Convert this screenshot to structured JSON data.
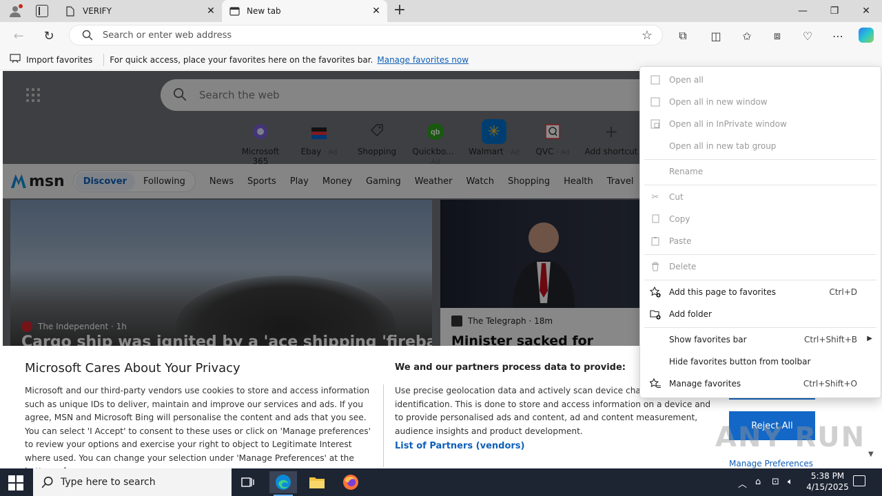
{
  "browser": {
    "tabs": [
      {
        "label": "VERIFY",
        "active": false
      },
      {
        "label": "New tab",
        "active": true
      }
    ],
    "address_placeholder": "Search or enter web address",
    "favorites_bar": {
      "import_label": "Import favorites",
      "hint": "For quick access, place your favorites here on the favorites bar.",
      "manage_link": "Manage favorites now"
    }
  },
  "newtab": {
    "search_placeholder": "Search the web",
    "shortcuts": [
      {
        "label": "Microsoft 365",
        "ad": ""
      },
      {
        "label": "Ebay",
        "ad": "· Ad"
      },
      {
        "label": "Shopping",
        "ad": ""
      },
      {
        "label": "Quickbo...",
        "ad": "· Ad"
      },
      {
        "label": "Walmart",
        "ad": "· Ad"
      },
      {
        "label": "QVC",
        "ad": "· Ad"
      },
      {
        "label": "Add shortcut",
        "ad": ""
      }
    ],
    "msn": {
      "logo": "msn",
      "segments": [
        "Discover",
        "Following"
      ],
      "nav": [
        "News",
        "Sports",
        "Play",
        "Money",
        "Gaming",
        "Weather",
        "Watch",
        "Shopping",
        "Health",
        "Travel"
      ]
    },
    "cards": [
      {
        "source": "The Independent",
        "time": "· 1h",
        "headline": "Cargo ship was ignited by a 'ace shipping 'fireballs'"
      },
      {
        "source": "The Telegraph",
        "time": "· 18m",
        "headline": "Minister sacked for"
      }
    ]
  },
  "privacy": {
    "title": "Microsoft Cares About Your Privacy",
    "body": "Microsoft and our third-party vendors use cookies to store and access information such as unique IDs to deliver, maintain and improve our services and ads. If you agree, MSN and Microsoft Bing will personalise the content and ads that you see. You can select 'I Accept' to consent to these uses or click on 'Manage preferences' to review your options and exercise your right to object to Legitimate Interest where used.  You can change your selection under 'Manage Preferences' at the bottom of",
    "col2_title": "We and our partners process data to provide:",
    "col2_body": "Use precise geolocation data and actively scan device characteristics for identification. This is done to store and access information on a device and to provide personalised ads and content, ad and content measurement, audience insights and product development.",
    "partners_link": "List of Partners (vendors)",
    "reject": "Reject All",
    "manage": "Manage Preferences",
    "watermark": "ANY RUN"
  },
  "context_menu": {
    "items": [
      {
        "label": "Open all",
        "shortcut": "",
        "disabled": true,
        "icon": "window-icon"
      },
      {
        "label": "Open all in new window",
        "shortcut": "",
        "disabled": true,
        "icon": "window-icon"
      },
      {
        "label": "Open all in InPrivate window",
        "shortcut": "",
        "disabled": true,
        "icon": "inprivate-icon"
      },
      {
        "label": "Open all in new tab group",
        "shortcut": "",
        "disabled": true,
        "icon": ""
      },
      {
        "label": "Rename",
        "shortcut": "",
        "disabled": true,
        "icon": ""
      },
      {
        "label": "Cut",
        "shortcut": "",
        "disabled": true,
        "icon": "scissors-icon"
      },
      {
        "label": "Copy",
        "shortcut": "",
        "disabled": true,
        "icon": "copy-icon"
      },
      {
        "label": "Paste",
        "shortcut": "",
        "disabled": true,
        "icon": "clipboard-icon"
      },
      {
        "label": "Delete",
        "shortcut": "",
        "disabled": true,
        "icon": "trash-icon"
      },
      {
        "label": "Add this page to favorites",
        "shortcut": "Ctrl+D",
        "disabled": false,
        "icon": "star-add-icon"
      },
      {
        "label": "Add folder",
        "shortcut": "",
        "disabled": false,
        "icon": "folder-add-icon"
      },
      {
        "label": "Show favorites bar",
        "shortcut": "Ctrl+Shift+B",
        "disabled": false,
        "icon": ""
      },
      {
        "label": "Hide favorites button from toolbar",
        "shortcut": "",
        "disabled": false,
        "icon": ""
      },
      {
        "label": "Manage favorites",
        "shortcut": "Ctrl+Shift+O",
        "disabled": false,
        "icon": "star-list-icon"
      }
    ]
  },
  "taskbar": {
    "search_placeholder": "Type here to search",
    "time": "5:38 PM",
    "date": "4/15/2025"
  },
  "colors": {
    "accent": "#0f5fb8",
    "button": "#1267c7",
    "taskbar": "#1d2533"
  }
}
